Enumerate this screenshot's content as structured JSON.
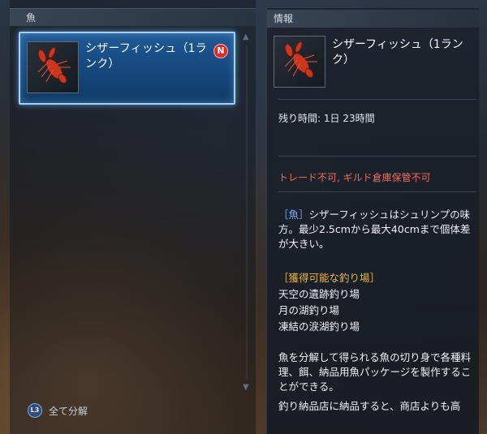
{
  "left_panel": {
    "header": "魚",
    "item": {
      "name": "シザーフィッシュ（1ランク）",
      "badge": "N"
    },
    "decompose": {
      "button": "L3",
      "label": "全て分解"
    }
  },
  "right_panel": {
    "header": "情報",
    "item_name": "シザーフィッシュ（1ランク）",
    "remaining_time": "残り時間: 1日 23時間",
    "restriction": "トレード不可, ギルド倉庫保管不可",
    "description_tag": "［魚］",
    "description": "シザーフィッシュはシュリンプの味方。最少2.5cmから最大40cmまで個体差が大きい。",
    "spots_title": "［獲得可能な釣り場］",
    "spots": [
      "天空の遺跡釣り場",
      "月の湖釣り場",
      "凍結の涙湖釣り場"
    ],
    "usage": "魚を分解して得られる魚の切り身で各種料理、餌、納品用魚パッケージを製作することができる。",
    "usage2": "釣り納品店に納品すると、商店よりも高"
  },
  "colors": {
    "selected_border": "#9fd0ff",
    "restriction": "#f06b5c",
    "tag_blue": "#6fa8ff",
    "tag_gold": "#e9b640"
  },
  "icons": [
    "lobster-icon",
    "new-badge-icon",
    "l3-button-icon",
    "scroll-up-icon",
    "scroll-down-icon"
  ]
}
